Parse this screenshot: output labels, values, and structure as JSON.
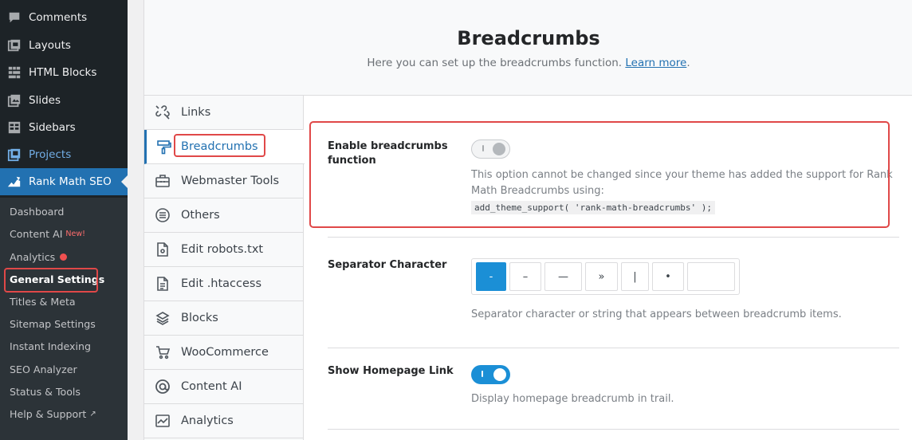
{
  "wp_menu": {
    "items": [
      {
        "label": "Comments",
        "icon": "comment-icon"
      },
      {
        "label": "Layouts",
        "icon": "layouts-icon"
      },
      {
        "label": "HTML Blocks",
        "icon": "html-blocks-icon"
      },
      {
        "label": "Slides",
        "icon": "slides-icon"
      },
      {
        "label": "Sidebars",
        "icon": "sidebars-icon"
      },
      {
        "label": "Projects",
        "icon": "projects-icon"
      },
      {
        "label": "Rank Math SEO",
        "icon": "rank-math-icon"
      }
    ],
    "submenu": [
      {
        "label": "Dashboard"
      },
      {
        "label": "Content AI",
        "badge": "New!"
      },
      {
        "label": "Analytics"
      },
      {
        "label": "General Settings"
      },
      {
        "label": "Titles & Meta"
      },
      {
        "label": "Sitemap Settings"
      },
      {
        "label": "Instant Indexing"
      },
      {
        "label": "SEO Analyzer"
      },
      {
        "label": "Status & Tools"
      },
      {
        "label": "Help & Support"
      }
    ]
  },
  "header": {
    "title": "Breadcrumbs",
    "subtitle": "Here you can set up the breadcrumbs function.",
    "learn_more": "Learn more",
    "period": "."
  },
  "tabs": [
    {
      "label": "Links",
      "icon": "links-icon"
    },
    {
      "label": "Breadcrumbs",
      "icon": "breadcrumbs-icon"
    },
    {
      "label": "Webmaster Tools",
      "icon": "toolbox-icon"
    },
    {
      "label": "Others",
      "icon": "list-circle-icon"
    },
    {
      "label": "Edit robots.txt",
      "icon": "file-icon"
    },
    {
      "label": "Edit .htaccess",
      "icon": "file-text-icon"
    },
    {
      "label": "Blocks",
      "icon": "blocks-icon"
    },
    {
      "label": "WooCommerce",
      "icon": "cart-icon"
    },
    {
      "label": "Content AI",
      "icon": "at-icon"
    },
    {
      "label": "Analytics",
      "icon": "analytics-icon"
    }
  ],
  "settings": {
    "enable": {
      "label_line1": "Enable breadcrumbs",
      "label_line2": "function",
      "desc_line1": "This option cannot be changed since your theme has added the support for Rank",
      "desc_line2": "Math Breadcrumbs using:",
      "code": "add_theme_support( 'rank-math-breadcrumbs' );",
      "state": "off"
    },
    "separator": {
      "label": "Separator Character",
      "options": [
        "-",
        "–",
        "—",
        "»",
        "|",
        "•"
      ],
      "selected": "-",
      "desc": "Separator character or string that appears between breadcrumb items."
    },
    "homepage": {
      "label": "Show Homepage Link",
      "desc": "Display homepage breadcrumb in trail.",
      "state": "on"
    }
  },
  "colors": {
    "accent": "#2271b1",
    "toggle_on": "#1b8fd6",
    "highlight": "#e04848",
    "sidebar_bg": "#1d2327"
  }
}
